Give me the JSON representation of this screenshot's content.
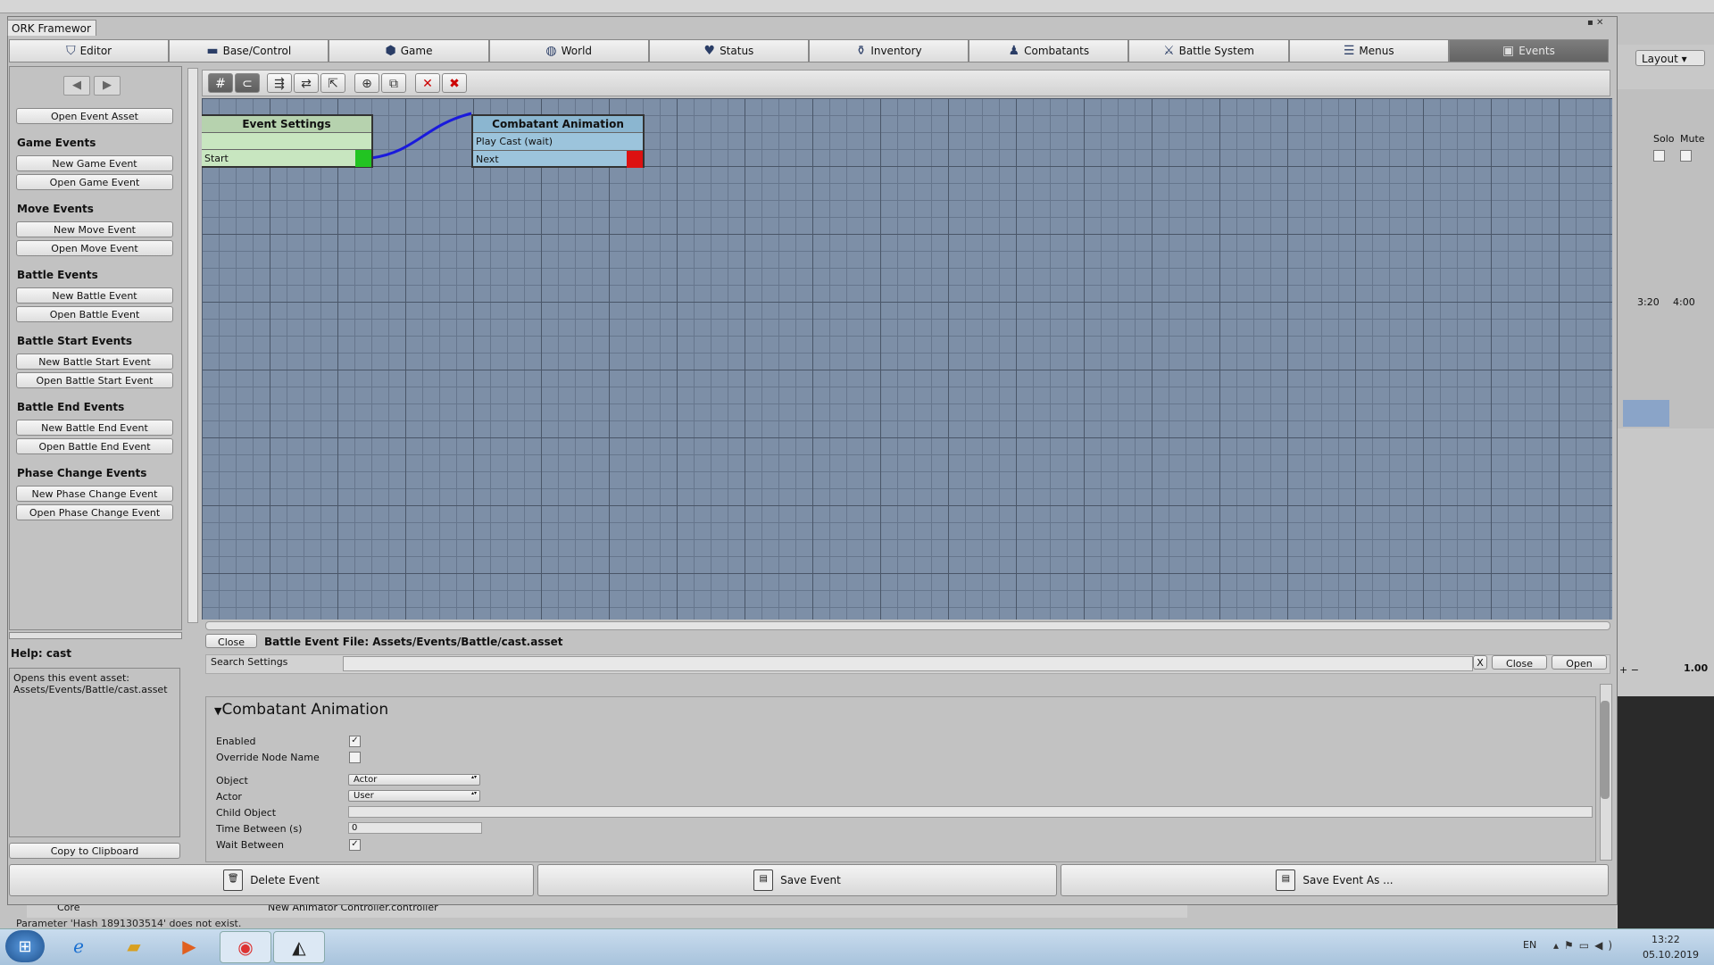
{
  "window": {
    "title": "ORK Framewor"
  },
  "unity": {
    "layout_label": "Layout",
    "solo_label": "Solo",
    "mute_label": "Mute",
    "time_a": "3:20",
    "time_b": "4:00",
    "slider_value": "1.00",
    "core_label": "Core",
    "controller_label": "New Animator Controller.controller",
    "status_message": "Parameter 'Hash 1891303514' does not exist."
  },
  "nav": {
    "tabs": [
      {
        "label": "Editor",
        "icon": "shield-icon"
      },
      {
        "label": "Base/Control",
        "icon": "gamepad-icon"
      },
      {
        "label": "Game",
        "icon": "cube-icon"
      },
      {
        "label": "World",
        "icon": "globe-icon"
      },
      {
        "label": "Status",
        "icon": "heart-icon"
      },
      {
        "label": "Inventory",
        "icon": "potion-icon"
      },
      {
        "label": "Combatants",
        "icon": "person-icon"
      },
      {
        "label": "Battle System",
        "icon": "sword-icon"
      },
      {
        "label": "Menus",
        "icon": "list-icon"
      },
      {
        "label": "Events",
        "icon": "clapper-icon"
      }
    ],
    "active": "Events"
  },
  "sidebar": {
    "open_asset": "Open Event Asset",
    "sections": [
      {
        "heading": "Game Events",
        "new": "New Game Event",
        "open": "Open Game Event"
      },
      {
        "heading": "Move Events",
        "new": "New Move Event",
        "open": "Open Move Event"
      },
      {
        "heading": "Battle Events",
        "new": "New Battle Event",
        "open": "Open Battle Event"
      },
      {
        "heading": "Battle Start Events",
        "new": "New Battle Start Event",
        "open": "Open Battle Start Event"
      },
      {
        "heading": "Battle End Events",
        "new": "New Battle End Event",
        "open": "Open Battle End Event"
      },
      {
        "heading": "Phase Change Events",
        "new": "New Phase Change Event",
        "open": "Open Phase Change Event"
      }
    ],
    "help_title": "Help: cast",
    "help_text": "Opens this event asset:\nAssets/Events/Battle/cast.asset",
    "copy_label": "Copy to Clipboard"
  },
  "nodes": {
    "event_settings": {
      "title": "Event Settings",
      "row": "Start"
    },
    "combatant_animation": {
      "title": "Combatant Animation",
      "row1": "Play Cast (wait)",
      "row2": "Next"
    }
  },
  "filebar": {
    "close_label": "Close",
    "file_title": "Battle Event File: Assets/Events/Battle/cast.asset",
    "search_label": "Search Settings",
    "search_value": "",
    "clear_label": "X",
    "close2_label": "Close",
    "open_label": "Open"
  },
  "settings": {
    "heading": "Combatant Animation",
    "enabled_label": "Enabled",
    "enabled": true,
    "override_label": "Override Node Name",
    "override": false,
    "object_label": "Object",
    "object_value": "Actor",
    "actor_label": "Actor",
    "actor_value": "User",
    "child_label": "Child Object",
    "child_value": "",
    "time_label": "Time Between (s)",
    "time_value": "0",
    "wait_label": "Wait Between",
    "wait": true
  },
  "bottom": {
    "delete_label": "Delete Event",
    "save_label": "Save Event",
    "save_as_label": "Save Event As ..."
  },
  "taskbar": {
    "language": "EN",
    "time": "13:22",
    "date": "05.10.2019"
  }
}
